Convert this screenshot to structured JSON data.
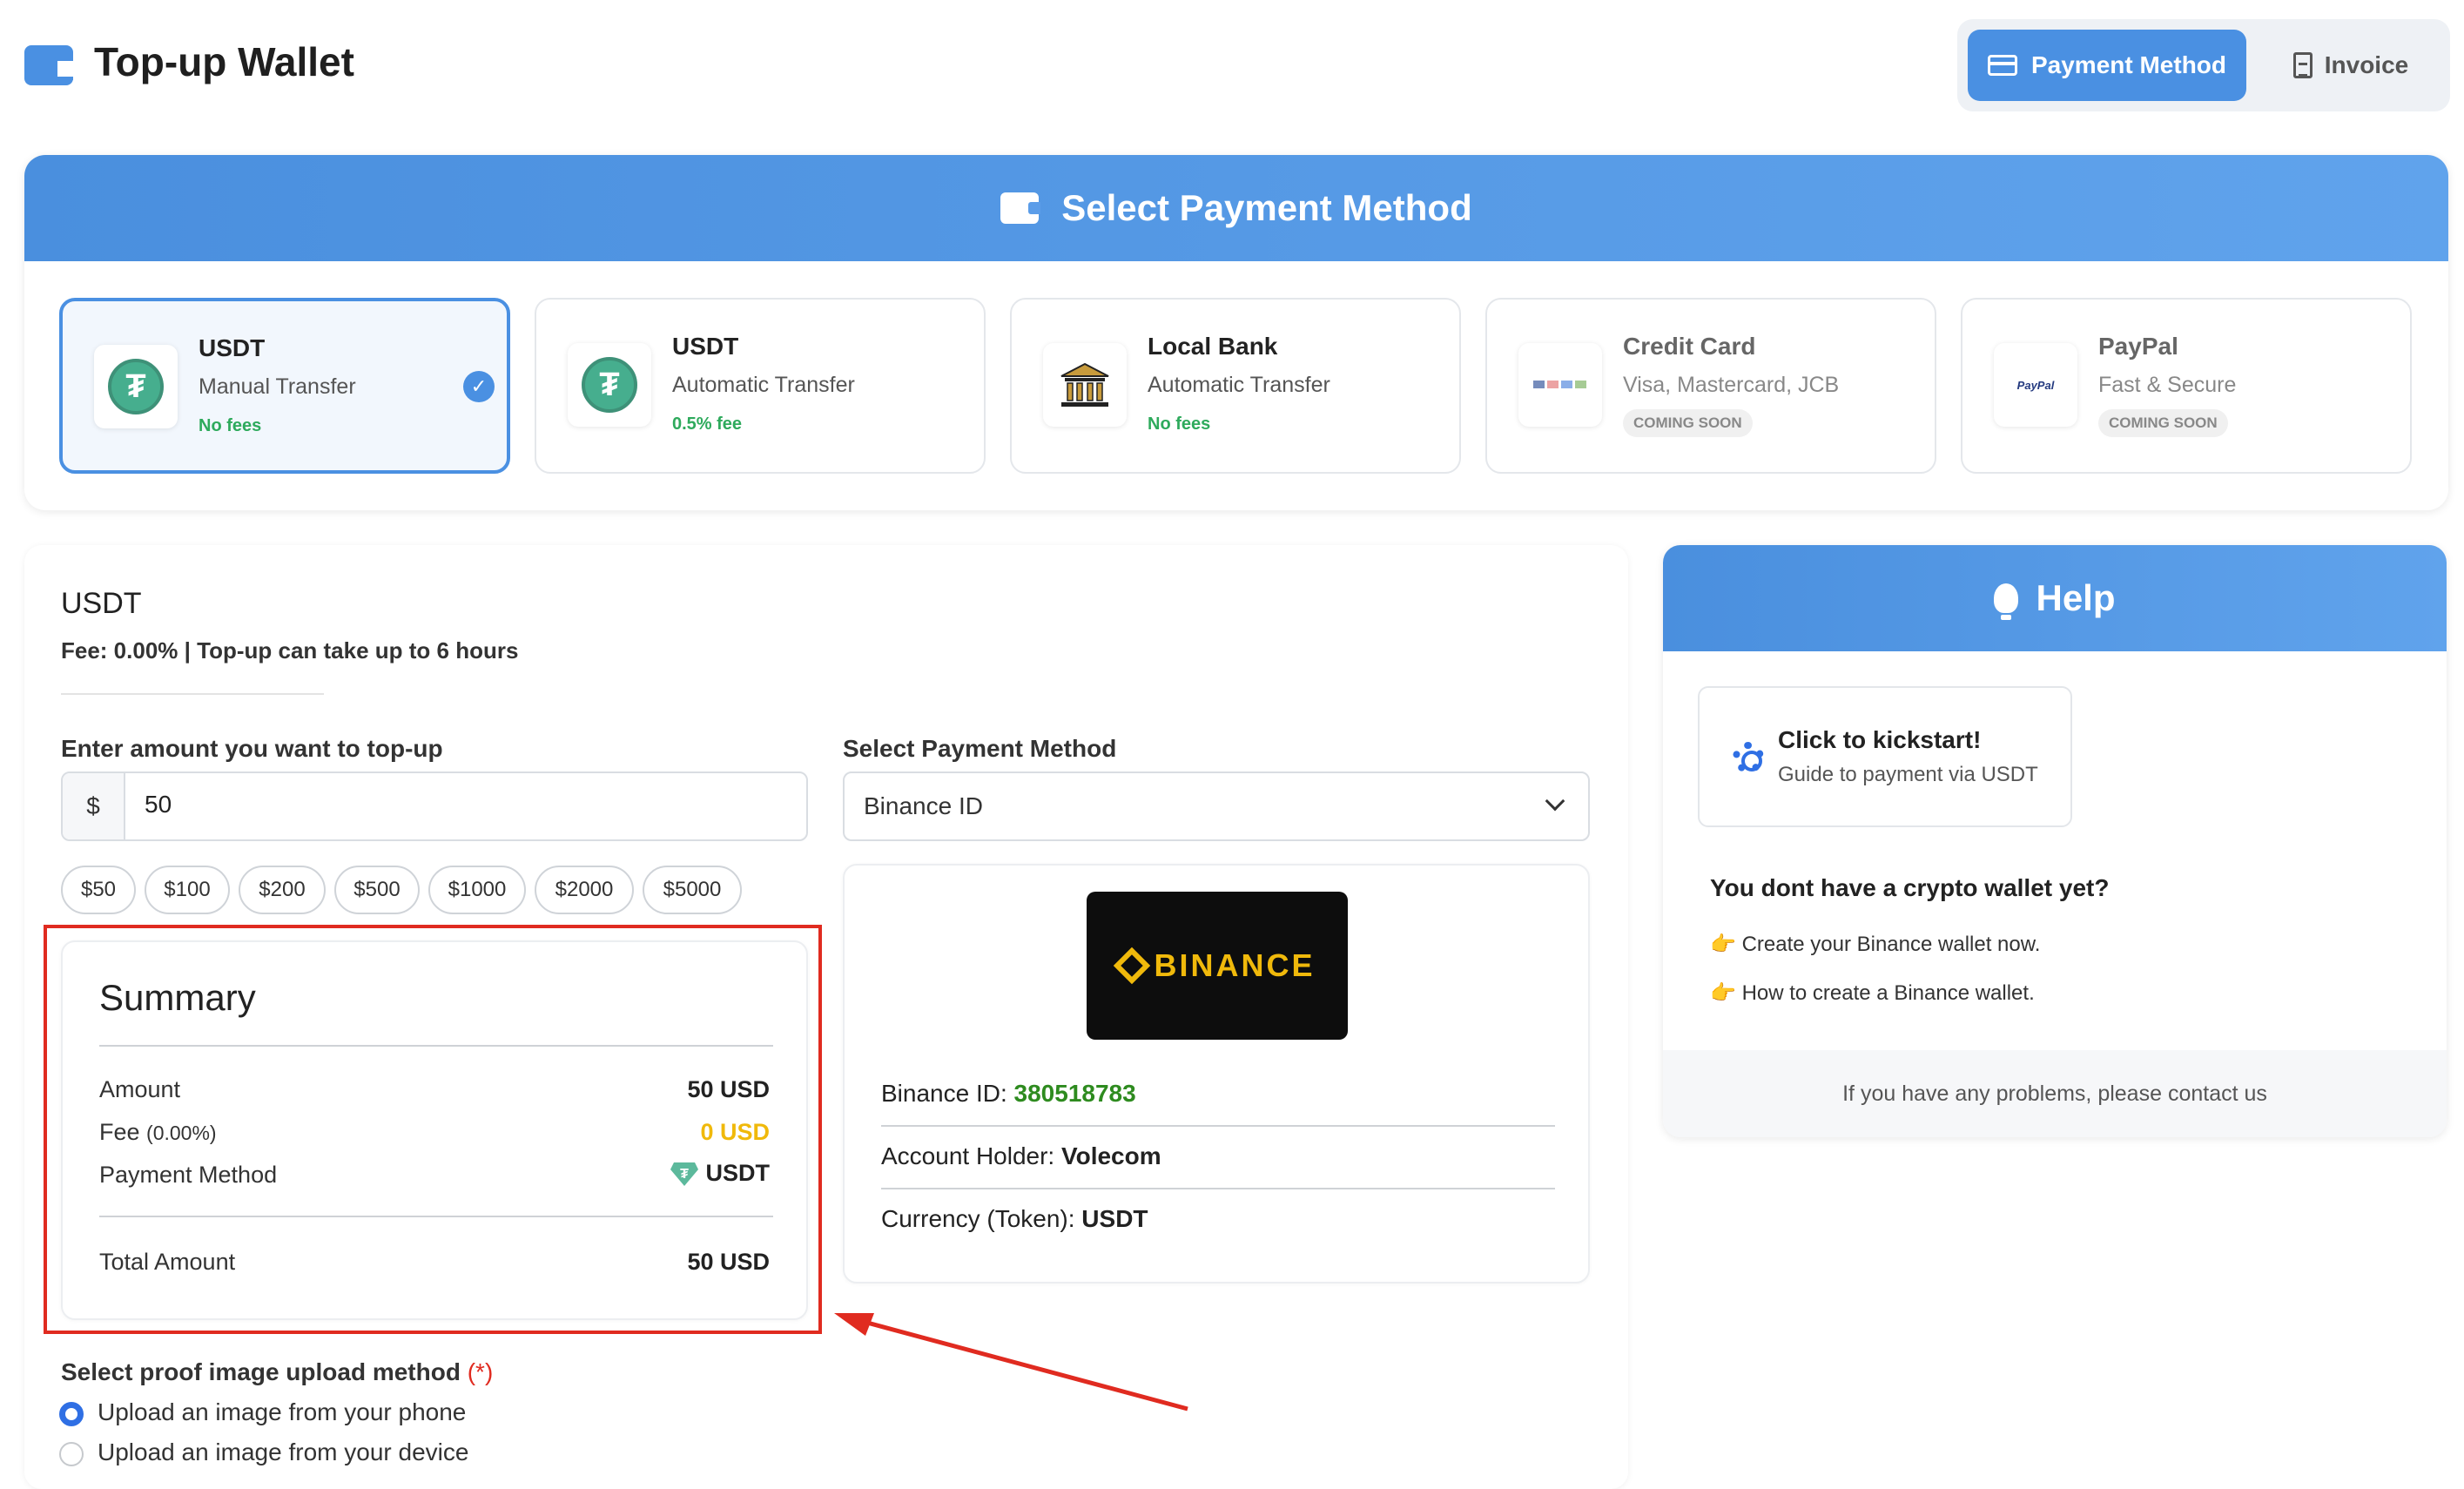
{
  "header": {
    "title": "Top-up Wallet",
    "tab_payment": "Payment Method",
    "tab_invoice": "Invoice"
  },
  "method_panel": {
    "title": "Select Payment Method"
  },
  "methods": [
    {
      "name": "USDT",
      "desc": "Manual Transfer",
      "fee": "No fees",
      "selected": true
    },
    {
      "name": "USDT",
      "desc": "Automatic Transfer",
      "fee": "0.5% fee"
    },
    {
      "name": "Local Bank",
      "desc": "Automatic Transfer",
      "fee": "No fees"
    },
    {
      "name": "Credit Card",
      "desc": "Visa, Mastercard, JCB",
      "badge": "COMING SOON"
    },
    {
      "name": "PayPal",
      "desc": "Fast & Secure",
      "badge": "COMING SOON",
      "logo_text": "PayPal"
    }
  ],
  "form": {
    "heading": "USDT",
    "fee_line": "Fee: 0.00% | Top-up can take up to 6 hours",
    "amount_label": "Enter amount you want to top-up",
    "currency_symbol": "$",
    "amount_value": "50",
    "chips": [
      "$50",
      "$100",
      "$200",
      "$500",
      "$1000",
      "$2000",
      "$5000"
    ],
    "select_label": "Select Payment Method",
    "select_value": "Binance ID"
  },
  "summary": {
    "title": "Summary",
    "amount_label": "Amount",
    "amount_value": "50 USD",
    "fee_label": "Fee",
    "fee_pct": "(0.00%)",
    "fee_value": "0 USD",
    "method_label": "Payment Method",
    "method_value": "USDT",
    "total_label": "Total Amount",
    "total_value": "50 USD"
  },
  "binance": {
    "logo_text": "BINANCE",
    "id_label": "Binance ID: ",
    "id_value": "380518783",
    "holder_label": "Account Holder: ",
    "holder_value": "Volecom",
    "currency_label": "Currency (Token): ",
    "currency_value": "USDT"
  },
  "proof": {
    "label": "Select proof image upload method",
    "required": "(*)",
    "option_phone": "Upload an image from your phone",
    "option_device": "Upload an image from your device",
    "selected": "phone"
  },
  "help": {
    "title": "Help",
    "kick_title": "Click to kickstart!",
    "kick_sub": "Guide to payment via USDT",
    "no_wallet": "You dont have a crypto wallet yet?",
    "link_create": "Create your Binance wallet now.",
    "link_howto": "How to create a Binance wallet.",
    "footer": "If you have any problems, please contact us"
  },
  "colors": {
    "accent": "#4a90e2",
    "fee_free": "#2eaa5c",
    "fee_warn": "#f0b90b",
    "binance_id": "#2e8b1f",
    "annotation": "#e02b20"
  },
  "icons": {
    "title": "wallet-icon",
    "tab_payment": "credit-card-icon",
    "tab_invoice": "document-icon",
    "help": "lightbulb-icon",
    "kick": "gear-icon",
    "pointer": "pointing-hand-icon",
    "usdt": "tether-icon",
    "bank": "bank-icon"
  }
}
